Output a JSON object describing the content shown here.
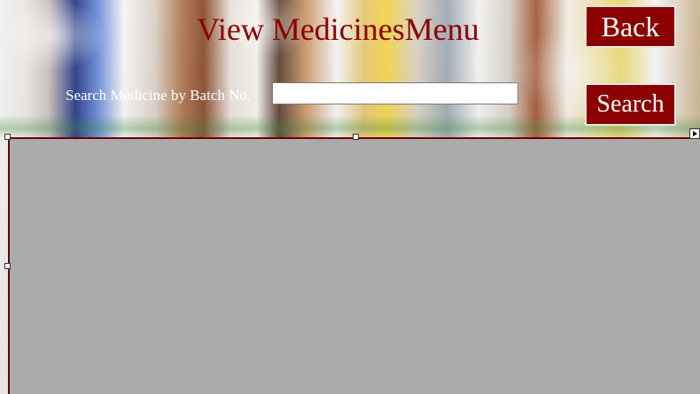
{
  "window": {
    "title": "View MedicinesMenu"
  },
  "toolbar": {
    "back_label": "Back",
    "search_label": "Search"
  },
  "search": {
    "label": "Search Medicine by Batch No.",
    "value": "",
    "placeholder": ""
  },
  "grid": {
    "rows": []
  },
  "colors": {
    "accent": "#8b0000",
    "grid_background": "#ababab",
    "label_text": "#ffffff"
  }
}
